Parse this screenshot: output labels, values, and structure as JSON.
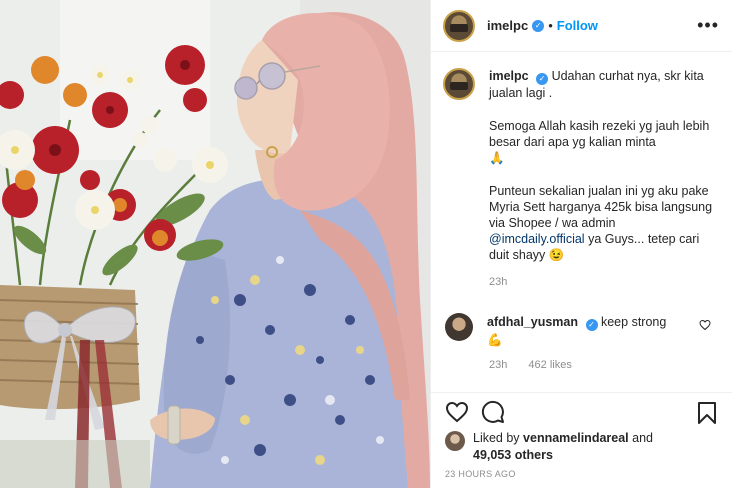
{
  "post": {
    "username": "imelpc",
    "follow_label": "Follow",
    "dot_separator": "•",
    "more_label": "•••"
  },
  "caption": {
    "username": "imelpc",
    "paragraph1": "Udahan curhat nya, skr kita jualan lagi .",
    "paragraph2": "Semoga Allah kasih rezeki yg jauh lebih besar dari apa yg kalian minta",
    "paragraph2_emoji": "🙏",
    "paragraph3_before": "Punteun sekalian jualan ini yg aku pake Myria Sett harganya 425k bisa langsung via Shopee / wa admin",
    "mention": "@imcdaily.official",
    "paragraph3_after": "ya Guys... tetep cari duit shayy",
    "paragraph3_emoji": "😉",
    "time": "23h"
  },
  "comment": {
    "username": "afdhal_yusman",
    "text": "keep strong",
    "emoji": "💪",
    "time": "23h",
    "likes": "462 likes"
  },
  "likes": {
    "prefix": "Liked by",
    "user": "vennamelindareal",
    "conj": "and",
    "others": "49,053 others"
  },
  "timestamp": "23 HOURS AGO",
  "icons": {
    "verified": "verified-badge-icon",
    "like": "heart-icon",
    "comment": "comment-bubble-icon",
    "save": "bookmark-icon",
    "more": "more-options-icon"
  },
  "colors": {
    "link": "#0095f6",
    "mention": "#00376b",
    "verified": "#3897f0",
    "muted": "#8e8e8e",
    "scarf": "#e8b2ab",
    "dress": "#a9b4d8"
  }
}
